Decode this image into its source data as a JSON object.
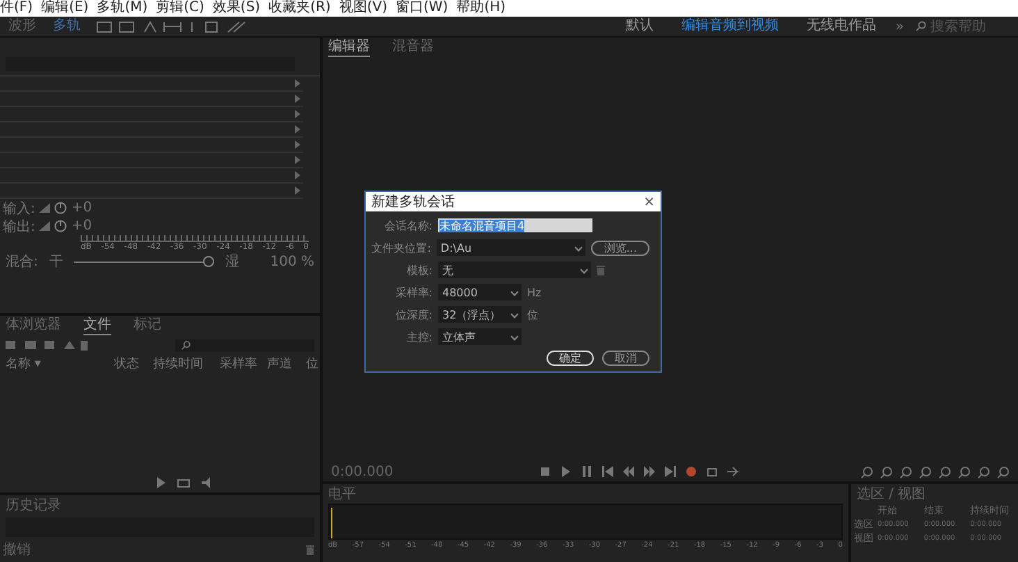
{
  "menu": [
    "件(F)",
    "编辑(E)",
    "多轨(M)",
    "剪辑(C)",
    "效果(S)",
    "收藏夹(R)",
    "视图(V)",
    "窗口(W)",
    "帮助(H)"
  ],
  "modes": [
    {
      "label": "波形",
      "selected": false
    },
    {
      "label": "多轨",
      "selected": true
    }
  ],
  "workspaces": [
    {
      "label": "默认",
      "selected": false
    },
    {
      "label": "编辑音频到视频",
      "selected": true
    },
    {
      "label": "无线电作品",
      "selected": false
    }
  ],
  "overflow": "»",
  "search": {
    "placeholder": "搜索帮助"
  },
  "io": [
    {
      "label": "输入:",
      "reading": "+0"
    },
    {
      "label": "输出:",
      "reading": "+0"
    }
  ],
  "rack_scale": [
    "dB",
    "-54",
    "-48",
    "-42",
    "-36",
    "-30",
    "-24",
    "-18",
    "-12",
    "-6",
    "0"
  ],
  "mix": {
    "label": "混合:",
    "dry": "干",
    "wet": "湿",
    "level": 1,
    "reading": "100 %"
  },
  "files": {
    "tabs": [
      {
        "label": "体浏览器",
        "selected": false
      },
      {
        "label": "文件",
        "selected": true
      },
      {
        "label": "标记",
        "selected": false
      }
    ],
    "columns": [
      "名称 ▾",
      "状态",
      "持续时间",
      "采样率",
      "声道",
      "位"
    ]
  },
  "history": {
    "title": "历史记录",
    "undo": "撤销"
  },
  "editor": {
    "tabs": [
      {
        "label": "编辑器",
        "selected": true
      },
      {
        "label": "混音器",
        "selected": false
      }
    ],
    "time": "0:00.000"
  },
  "levels": {
    "title": "电平",
    "scale": [
      "dB",
      "-57",
      "-54",
      "-51",
      "-48",
      "-45",
      "-42",
      "-39",
      "-36",
      "-33",
      "-30",
      "-27",
      "-24",
      "-21",
      "-18",
      "-15",
      "-12",
      "-9",
      "-6",
      "-3",
      "0"
    ]
  },
  "selection": {
    "title": "选区 / 视图",
    "columns": [
      "开始",
      "结束",
      "持续时间"
    ],
    "rows": [
      {
        "label": "选区",
        "values": [
          "0:00.000",
          "0:00.000",
          "0:00.000"
        ]
      },
      {
        "label": "视图",
        "values": [
          "0:00.000",
          "0:00.000",
          "0:00.000"
        ]
      }
    ]
  },
  "dialog": {
    "title": "新建多轨会话",
    "close": "×",
    "fields": [
      {
        "kind": "text",
        "label": "会话名称:",
        "value": "未命名混音项目4"
      },
      {
        "kind": "select",
        "label": "文件夹位置:",
        "value": "D:\\Au",
        "button": "浏览..."
      },
      {
        "kind": "select",
        "label": "模板:",
        "value": "无",
        "trash": true
      },
      {
        "kind": "select",
        "label": "采样率:",
        "value": "48000",
        "unit": "Hz"
      },
      {
        "kind": "select",
        "label": "位深度:",
        "value": "32（浮点）",
        "unit": "位"
      },
      {
        "kind": "select",
        "label": "主控:",
        "value": "立体声"
      }
    ],
    "buttons": [
      {
        "label": "确定",
        "default": true
      },
      {
        "label": "取消",
        "default": false
      }
    ]
  }
}
